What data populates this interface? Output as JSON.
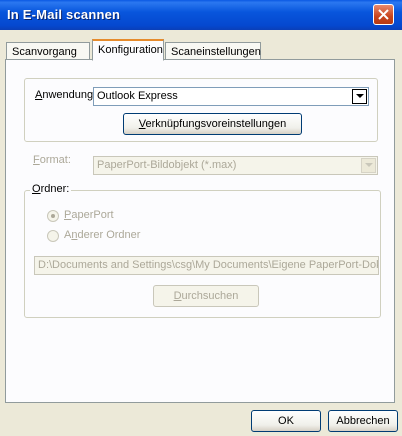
{
  "window": {
    "title": "In E-Mail scannen"
  },
  "tabs": [
    {
      "label": "Scanvorgang"
    },
    {
      "label": "Konfiguration"
    },
    {
      "label": "Scaneinstellungen"
    }
  ],
  "anwendung": {
    "label_mnemonic": "A",
    "label_rest": "nwendung:",
    "value": "Outlook Express",
    "button_mnemonic": "V",
    "button_rest": "erknüpfungsvoreinstellungen"
  },
  "format": {
    "label_mnemonic": "F",
    "label_rest": "ormat:",
    "value": "PaperPort-Bildobjekt (*.max)"
  },
  "ordner": {
    "label_mnemonic": "O",
    "label_rest": "rdner:",
    "radio1_pre": "",
    "radio1_mnemonic": "P",
    "radio1_rest": "aperPort",
    "radio2_pre": "A",
    "radio2_mnemonic": "n",
    "radio2_rest": "derer Ordner",
    "path": "D:\\Documents and Settings\\csg\\My Documents\\Eigene PaperPort-Dok",
    "browse_mnemonic": "D",
    "browse_rest": "urchsuchen",
    "selected": "PaperPort"
  },
  "footer": {
    "ok": "OK",
    "cancel": "Abbrechen"
  }
}
